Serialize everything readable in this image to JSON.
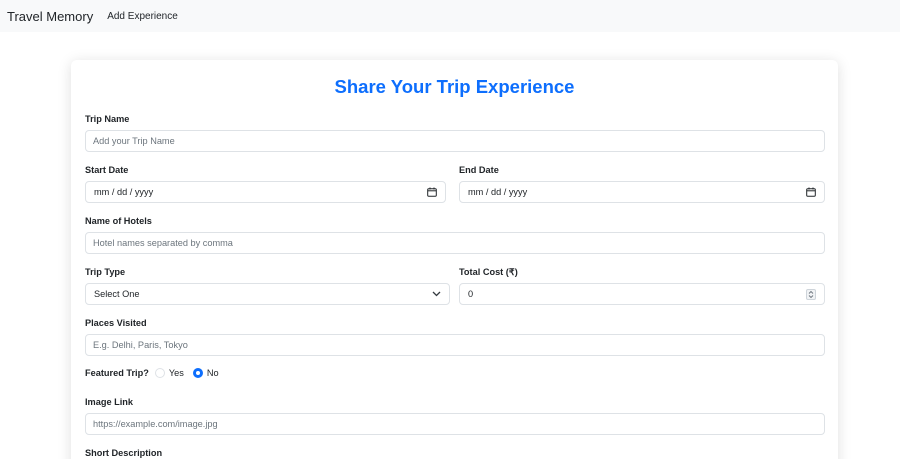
{
  "navbar": {
    "brand": "Travel Memory",
    "link": "Add Experience"
  },
  "form": {
    "title": "Share Your Trip Experience",
    "trip_name": {
      "label": "Trip Name",
      "placeholder": "Add your Trip Name"
    },
    "start_date": {
      "label": "Start Date",
      "placeholder": "mm / dd / yyyy",
      "icon": "calendar-icon"
    },
    "end_date": {
      "label": "End Date",
      "placeholder": "mm / dd / yyyy",
      "icon": "calendar-icon"
    },
    "hotels": {
      "label": "Name of Hotels",
      "placeholder": "Hotel names separated by comma"
    },
    "trip_type": {
      "label": "Trip Type",
      "selected": "Select One",
      "icon": "chevron-down-icon"
    },
    "total_cost": {
      "label": "Total Cost (₹)",
      "value": "0"
    },
    "places": {
      "label": "Places Visited",
      "placeholder": "E.g. Delhi, Paris, Tokyo"
    },
    "featured": {
      "label": "Featured Trip?",
      "options": [
        "Yes",
        "No"
      ],
      "selected": "No"
    },
    "image_link": {
      "label": "Image Link",
      "placeholder": "https://example.com/image.jpg"
    },
    "short_description": {
      "label": "Short Description"
    }
  },
  "colors": {
    "accent": "#0d6efd",
    "navbar_bg": "#f8f9fa",
    "border": "#dee2e6"
  }
}
